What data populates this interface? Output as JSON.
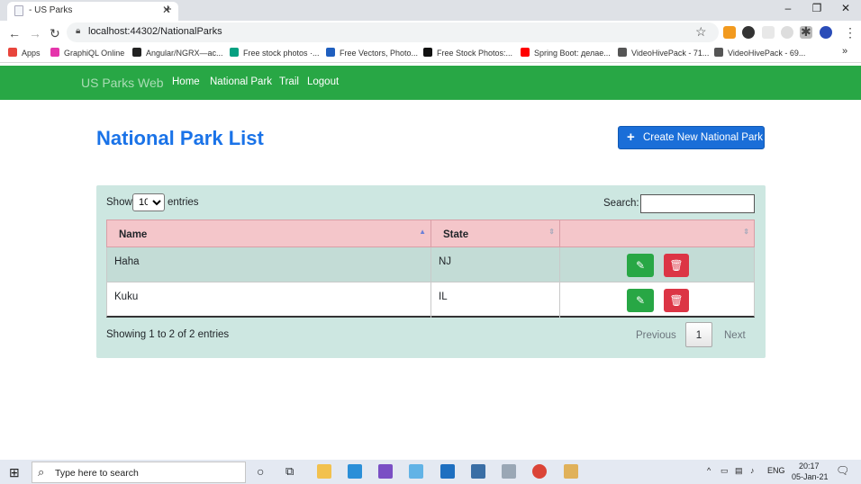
{
  "browser": {
    "tab_title": "- US Parks",
    "url": "localhost:44302/NationalParks",
    "bookmarks": [
      {
        "label": "Apps",
        "color": "#e8453c"
      },
      {
        "label": "GraphiQL Online",
        "color": "#e535ab"
      },
      {
        "label": "Angular/NGRX—ac...",
        "color": "#222222"
      },
      {
        "label": "Free stock photos ·...",
        "color": "#05a081"
      },
      {
        "label": "Free Vectors, Photo...",
        "color": "#1f5fbf"
      },
      {
        "label": "Free Stock Photos:...",
        "color": "#111111"
      },
      {
        "label": "Spring Boot: делае...",
        "color": "#ff0000"
      },
      {
        "label": "VideoHivePack - 71...",
        "color": "#555555"
      },
      {
        "label": "VideoHivePack - 69...",
        "color": "#555555"
      }
    ],
    "window_controls": {
      "minimize": "–",
      "maximize": "❐",
      "close": "✕"
    }
  },
  "navbar": {
    "brand": "US Parks Web",
    "links": [
      "Home",
      "National Park",
      "Trail",
      "Logout"
    ]
  },
  "page": {
    "title": "National Park List",
    "create_button": "Create New National Park"
  },
  "table": {
    "show_label": "Show",
    "entries_value": "10",
    "entries_label": "entries",
    "search_label": "Search:",
    "search_value": "",
    "columns": [
      "Name",
      "State",
      ""
    ],
    "rows": [
      {
        "name": "Haha",
        "state": "NJ"
      },
      {
        "name": "Kuku",
        "state": "IL"
      }
    ],
    "info": "Showing 1 to 2 of 2 entries",
    "previous": "Previous",
    "page": "1",
    "next": "Next"
  },
  "taskbar": {
    "search_placeholder": "Type here to search",
    "language": "ENG",
    "time": "20:17",
    "date": "05-Jan-21"
  },
  "colors": {
    "navbar": "#28a745",
    "title": "#1a73e8",
    "primary_button": "#1a6ed8",
    "panel": "#cde7e1",
    "header_row": "#f4c6ca",
    "edit_button": "#28a745",
    "delete_button": "#dc3545"
  }
}
